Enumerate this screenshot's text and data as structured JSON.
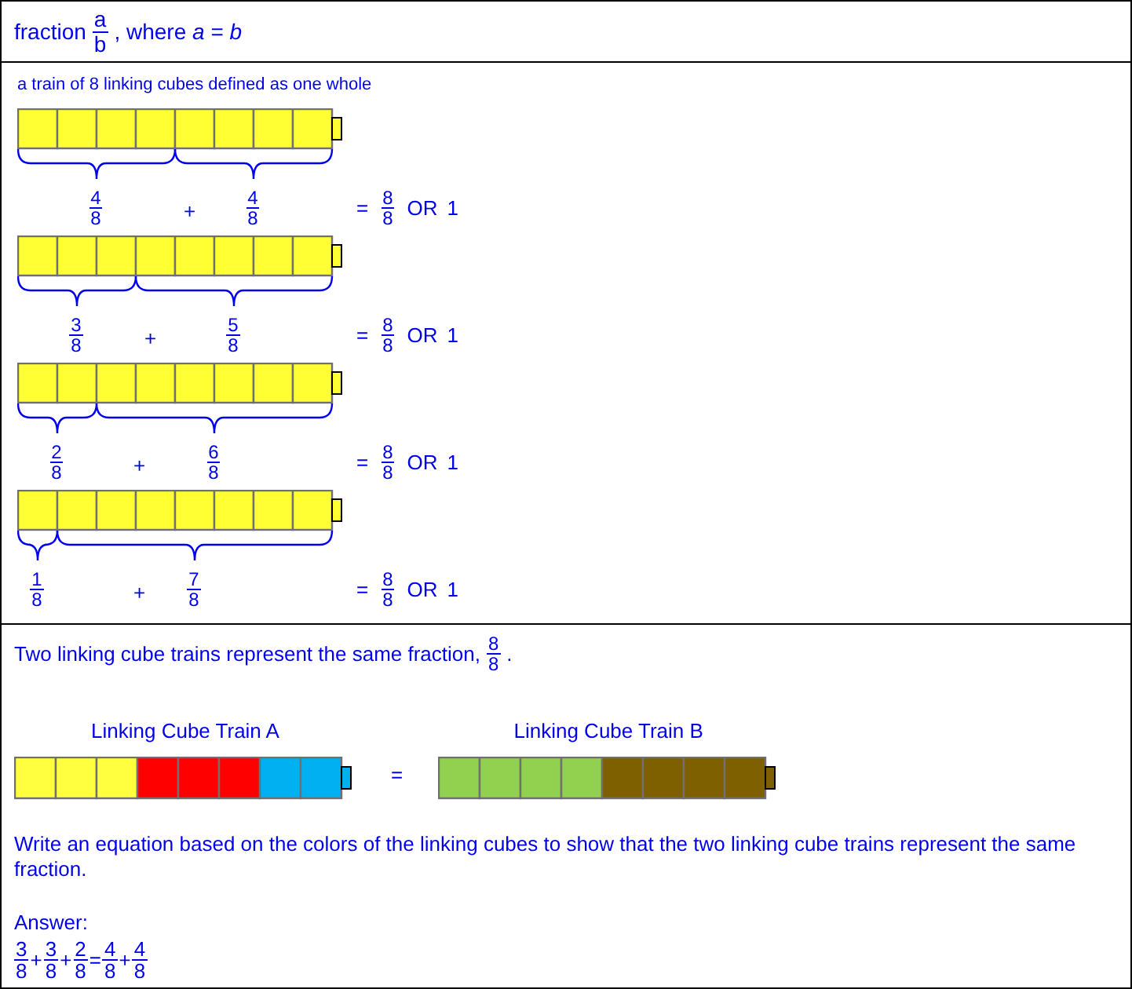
{
  "header": {
    "prefix": "fraction",
    "fraction": {
      "num": "a",
      "den": "b"
    },
    "suffix": ", where *a* = *b*"
  },
  "whole": {
    "caption": "a train of 8 linking cubes defined as one whole",
    "examples": [
      {
        "parts": [
          {
            "fraction": {
              "num": "4",
              "den": "8"
            },
            "cubes": [
              {
                "color": "#ffff33"
              },
              {
                "color": "#ffff33"
              },
              {
                "color": "#ffff33"
              },
              {
                "color": "#ffff33"
              }
            ]
          },
          {
            "fraction": {
              "num": "4",
              "den": "8"
            },
            "cubes": [
              {
                "color": "#ffff33"
              },
              {
                "color": "#ffff33"
              },
              {
                "color": "#ffff33"
              },
              {
                "color": "#ffff33"
              }
            ]
          }
        ],
        "plus": "+",
        "equals": "=",
        "total": {
          "num": "8",
          "den": "8"
        },
        "or": "OR",
        "alt": "1"
      },
      {
        "parts": [
          {
            "fraction": {
              "num": "3",
              "den": "8"
            },
            "cubes": [
              {
                "color": "#ffff33"
              },
              {
                "color": "#ffff33"
              },
              {
                "color": "#ffff33"
              }
            ]
          },
          {
            "fraction": {
              "num": "5",
              "den": "8"
            },
            "cubes": [
              {
                "color": "#ffff33"
              },
              {
                "color": "#ffff33"
              },
              {
                "color": "#ffff33"
              },
              {
                "color": "#ffff33"
              },
              {
                "color": "#ffff33"
              }
            ]
          }
        ],
        "plus": "+",
        "equals": "=",
        "total": {
          "num": "8",
          "den": "8"
        },
        "or": "OR",
        "alt": "1"
      },
      {
        "parts": [
          {
            "fraction": {
              "num": "2",
              "den": "8"
            },
            "cubes": [
              {
                "color": "#ffff33"
              },
              {
                "color": "#ffff33"
              }
            ]
          },
          {
            "fraction": {
              "num": "6",
              "den": "8"
            },
            "cubes": [
              {
                "color": "#ffff33"
              },
              {
                "color": "#ffff33"
              },
              {
                "color": "#ffff33"
              },
              {
                "color": "#ffff33"
              },
              {
                "color": "#ffff33"
              },
              {
                "color": "#ffff33"
              }
            ]
          }
        ],
        "plus": "+",
        "equals": "=",
        "total": {
          "num": "8",
          "den": "8"
        },
        "or": "OR",
        "alt": "1"
      },
      {
        "parts": [
          {
            "fraction": {
              "num": "1",
              "den": "8"
            },
            "cubes": [
              {
                "color": "#ffff33"
              }
            ]
          },
          {
            "fraction": {
              "num": "7",
              "den": "8"
            },
            "cubes": [
              {
                "color": "#ffff33"
              },
              {
                "color": "#ffff33"
              },
              {
                "color": "#ffff33"
              },
              {
                "color": "#ffff33"
              },
              {
                "color": "#ffff33"
              },
              {
                "color": "#ffff33"
              },
              {
                "color": "#ffff33"
              }
            ]
          }
        ],
        "plus": "+",
        "equals": "=",
        "total": {
          "num": "8",
          "den": "8"
        },
        "or": "OR",
        "alt": "1"
      }
    ]
  },
  "problem": {
    "intro": "Two linking cube trains represent the same fraction,",
    "intro_fraction": {
      "num": "8",
      "den": "8"
    },
    "intro_end": ".",
    "trains": [
      {
        "label": "Linking Cube Train A",
        "cubes": [
          {
            "color": "#ffff40"
          },
          {
            "color": "#ffff40"
          },
          {
            "color": "#ffff40"
          },
          {
            "color": "#ff0000"
          },
          {
            "color": "#ff0000"
          },
          {
            "color": "#ff0000"
          },
          {
            "color": "#00b0f0"
          },
          {
            "color": "#00b0f0"
          }
        ]
      },
      {
        "label": "Linking Cube Train B",
        "cubes": [
          {
            "color": "#92d050"
          },
          {
            "color": "#92d050"
          },
          {
            "color": "#92d050"
          },
          {
            "color": "#92d050"
          },
          {
            "color": "#7f6000"
          },
          {
            "color": "#7f6000"
          },
          {
            "color": "#7f6000"
          },
          {
            "color": "#7f6000"
          }
        ]
      }
    ],
    "equals": "=",
    "question": "Write an equation based on the colors of the linking cubes to show that the two linking cube trains represent the same fraction.",
    "answer_label": "Answer:",
    "answer": [
      {
        "kind": "fraction",
        "num": "3",
        "den": "8"
      },
      {
        "kind": "operator",
        "text": "+"
      },
      {
        "kind": "fraction",
        "num": "3",
        "den": "8"
      },
      {
        "kind": "operator",
        "text": "+"
      },
      {
        "kind": "fraction",
        "num": "2",
        "den": "8"
      },
      {
        "kind": "operator",
        "text": "="
      },
      {
        "kind": "fraction",
        "num": "4",
        "den": "8"
      },
      {
        "kind": "operator",
        "text": "+"
      },
      {
        "kind": "fraction",
        "num": "4",
        "den": "8"
      }
    ]
  }
}
